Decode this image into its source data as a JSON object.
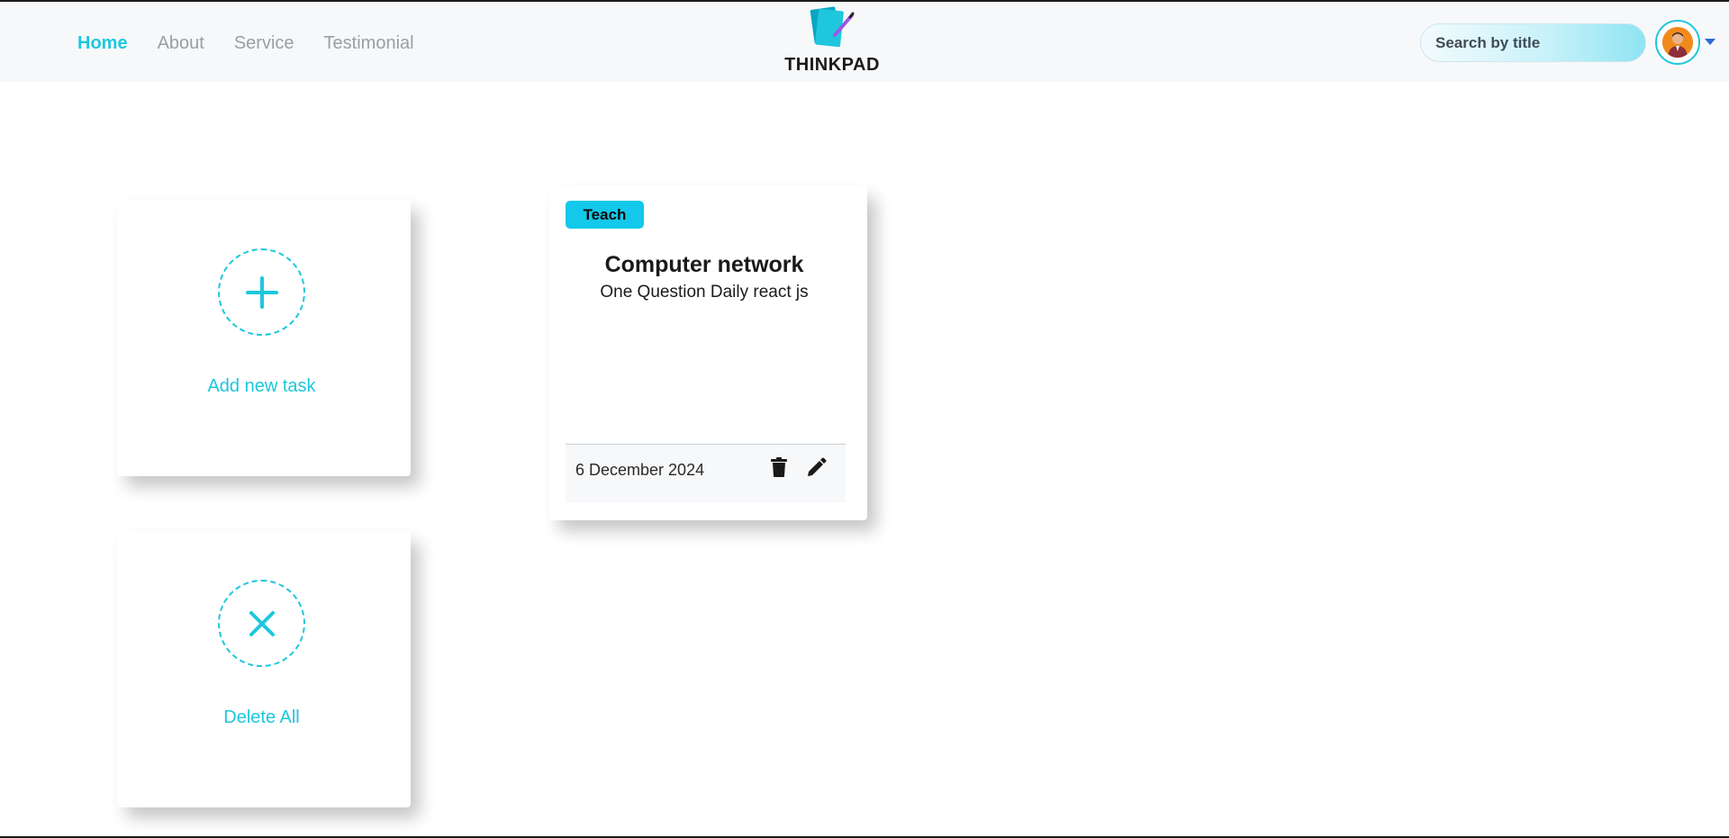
{
  "header": {
    "nav": [
      {
        "label": "Home",
        "active": true
      },
      {
        "label": "About",
        "active": false
      },
      {
        "label": "Service",
        "active": false
      },
      {
        "label": "Testimonial",
        "active": false
      }
    ],
    "brand": "THINKPAD",
    "search_placeholder": "Search by title",
    "logo_icon": "notepad-pencil-icon",
    "avatar_icon": "user-avatar",
    "dropdown_icon": "caret-down-icon"
  },
  "actions": {
    "add_label": "Add new task",
    "add_icon": "plus-icon",
    "delete_all_label": "Delete All",
    "delete_all_icon": "close-icon"
  },
  "notes": [
    {
      "tag": "Teach",
      "title": "Computer network",
      "description": "One Question Daily react js",
      "date": "6 December 2024",
      "delete_icon": "trash-icon",
      "edit_icon": "pencil-icon"
    }
  ],
  "colors": {
    "accent": "#1ec7dd",
    "tag_bg": "#13c8ea",
    "nav_inactive": "#9a9ea5",
    "navbar_bg": "#f7f8fa"
  }
}
